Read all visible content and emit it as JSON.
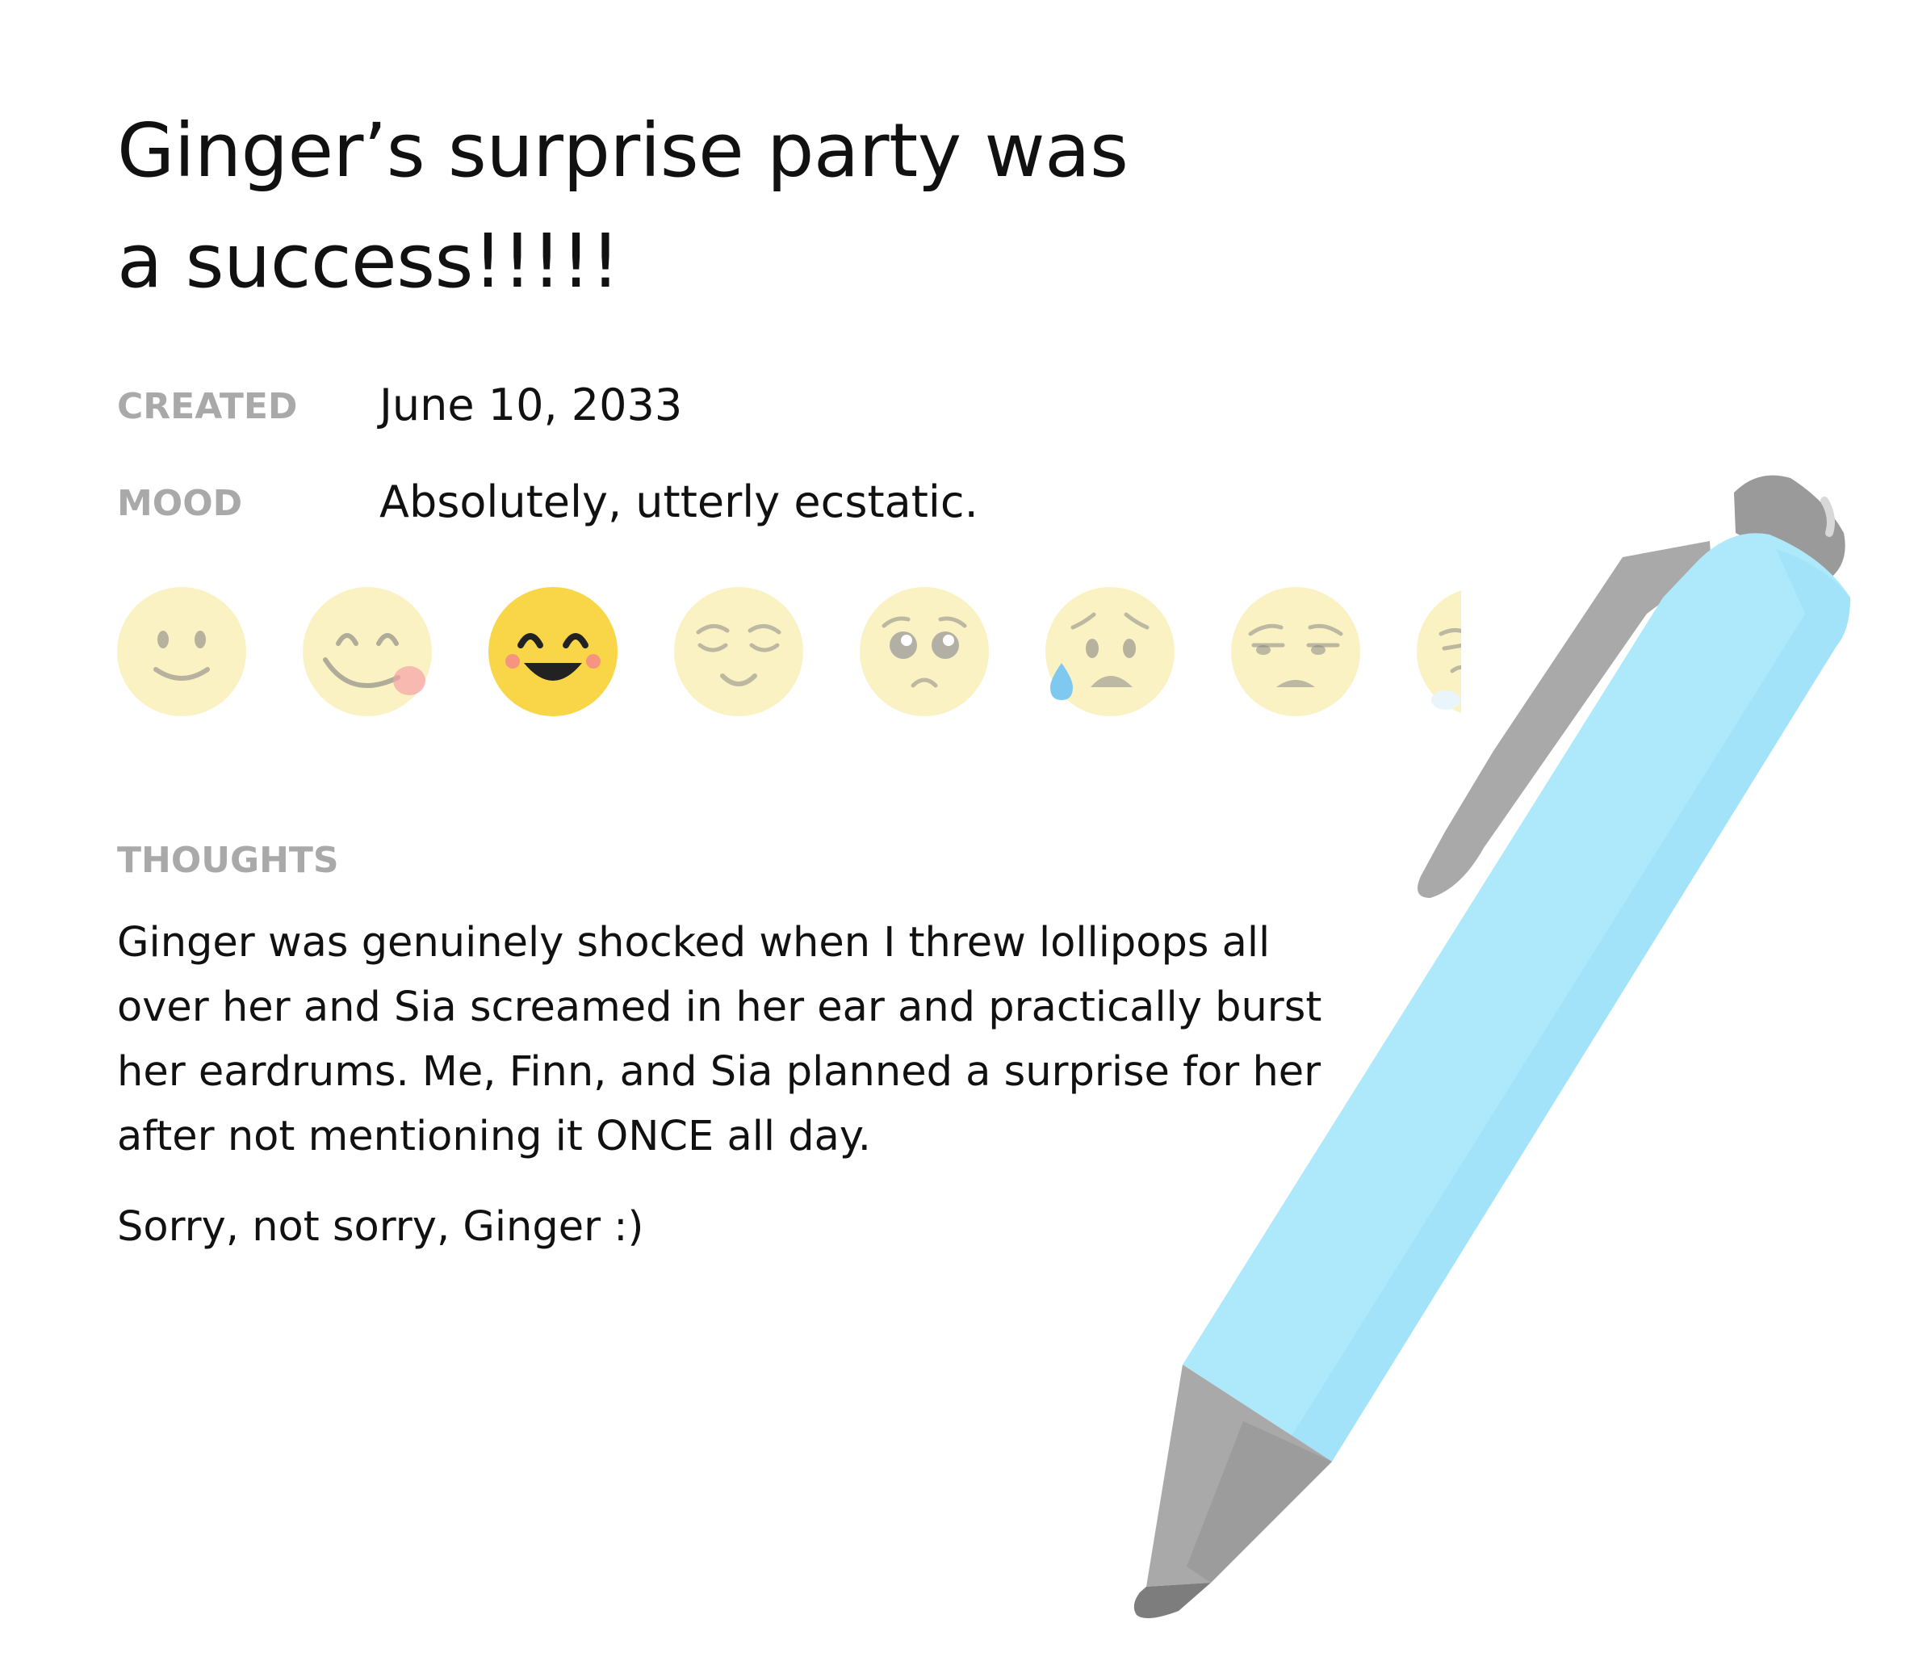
{
  "entry": {
    "title": "Ginger’s surprise party was a success!!!!!",
    "created_label": "CREATED",
    "created_value": "June 10, 2033",
    "mood_label": "MOOD",
    "mood_value": "Absolutely, utterly ecstatic.",
    "thoughts_label": "THOUGHTS",
    "thoughts": [
      "Ginger was genuinely shocked when I threw lollipops all over her and Sia screamed in her ear and practically burst her eardrums. Me, Finn, and Sia planned a surprise for her after not mentioning it ONCE all day.",
      "Sorry, not sorry, Ginger :)"
    ]
  },
  "moods": {
    "selected": "smiling-eyes",
    "items": [
      "slight-smile",
      "yum",
      "smiling-eyes",
      "relieved",
      "pleading",
      "sad-sweat",
      "unamused",
      "partial"
    ],
    "colors": {
      "inactive": "#fbf2c4",
      "active": "#f9d548",
      "feature": "#7d7d7d",
      "blush": "#f7a1a8",
      "tear": "#7fc8ef"
    }
  },
  "pen": {
    "body_color": "#aee9fb",
    "metal_color": "#a9a9a9"
  }
}
